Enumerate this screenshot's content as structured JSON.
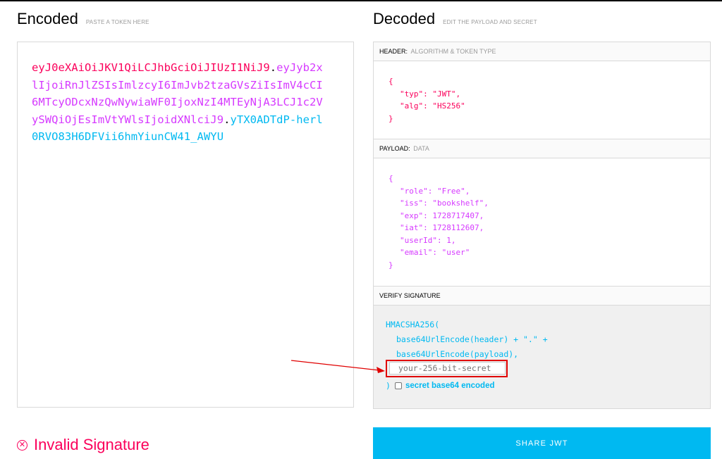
{
  "encoded": {
    "title": "Encoded",
    "subtitle": "PASTE A TOKEN HERE",
    "token_header": "eyJ0eXAiOiJKV1QiLCJhbGciOiJIUzI1NiJ9",
    "dot": ".",
    "token_payload": "eyJyb2xlIjoiRnJlZSIsImlzcyI6ImJvb2tzaGVsZiIsImV4cCI6MTcyODcxNzQwNywiaWF0IjoxNzI4MTEyNjA3LCJ1c2VySWQiOjEsImVtYWlsIjoidXNlciJ9",
    "token_signature": "yTX0ADTdP-herl0RVO83H6DFVii6hmYiunCW41_AWYU"
  },
  "decoded": {
    "title": "Decoded",
    "subtitle": "EDIT THE PAYLOAD AND SECRET",
    "header_section": {
      "label": "HEADER:",
      "sub": "ALGORITHM & TOKEN TYPE",
      "lines": [
        "{",
        "\"typ\": \"JWT\",",
        "\"alg\": \"HS256\"",
        "}"
      ]
    },
    "payload_section": {
      "label": "PAYLOAD:",
      "sub": "DATA",
      "lines": [
        "{",
        "\"role\": \"Free\",",
        "\"iss\": \"bookshelf\",",
        "\"exp\": 1728717407,",
        "\"iat\": 1728112607,",
        "\"userId\": 1,",
        "\"email\": \"user\"",
        "}"
      ]
    },
    "verify_section": {
      "label": "VERIFY SIGNATURE",
      "line1": "HMACSHA256(",
      "line2": "base64UrlEncode(header) + \".\" +",
      "line3": "base64UrlEncode(payload),",
      "secret_placeholder": "your-256-bit-secret",
      "close": ")",
      "base64_label": "secret base64 encoded",
      "base64_checked": false
    }
  },
  "status": {
    "text": "Invalid Signature",
    "color": "#fb015b"
  },
  "share_button": "SHARE JWT",
  "colors": {
    "header": "#fb015b",
    "payload": "#d63aff",
    "signature": "#00b9f1",
    "annotation": "#e00000"
  }
}
